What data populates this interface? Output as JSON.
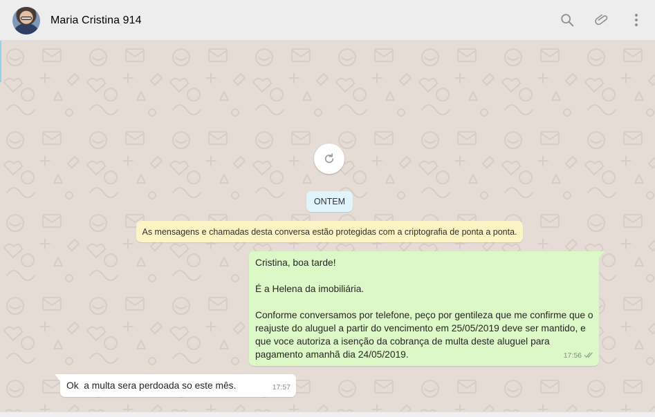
{
  "header": {
    "contact_name": "Maria Cristina 914",
    "avatar_icon": "contact-avatar",
    "search_icon": "search-icon",
    "attach_icon": "paperclip-icon",
    "menu_icon": "more-vertical-icon",
    "icon_color": "#919191"
  },
  "chat": {
    "background_color": "#e5ddd5",
    "reload_icon": "refresh-icon",
    "date_divider": "ONTEM",
    "encryption_notice": "As mensagens e chamadas desta conversa estão protegidas com a criptografia de ponta a ponta.",
    "messages": [
      {
        "direction": "outgoing",
        "text": "Cristina, boa tarde!\n\nÉ a Helena da imobiliária.\n\nConforme conversamos por telefone, peço por gentileza que me confirme que o reajuste do aluguel a partir do vencimento em 25/05/2019 deve ser mantido, e que voce autoriza a isenção da cobrança de multa deste aluguel para pagamento amanhã dia 24/05/2019.",
        "time": "17:56",
        "status_icon": "double-check-icon",
        "bubble_color": "#dcf8c6"
      },
      {
        "direction": "incoming",
        "text": "Ok  a multa sera perdoada so este mês.",
        "time": "17:57",
        "bubble_color": "#ffffff"
      }
    ]
  }
}
